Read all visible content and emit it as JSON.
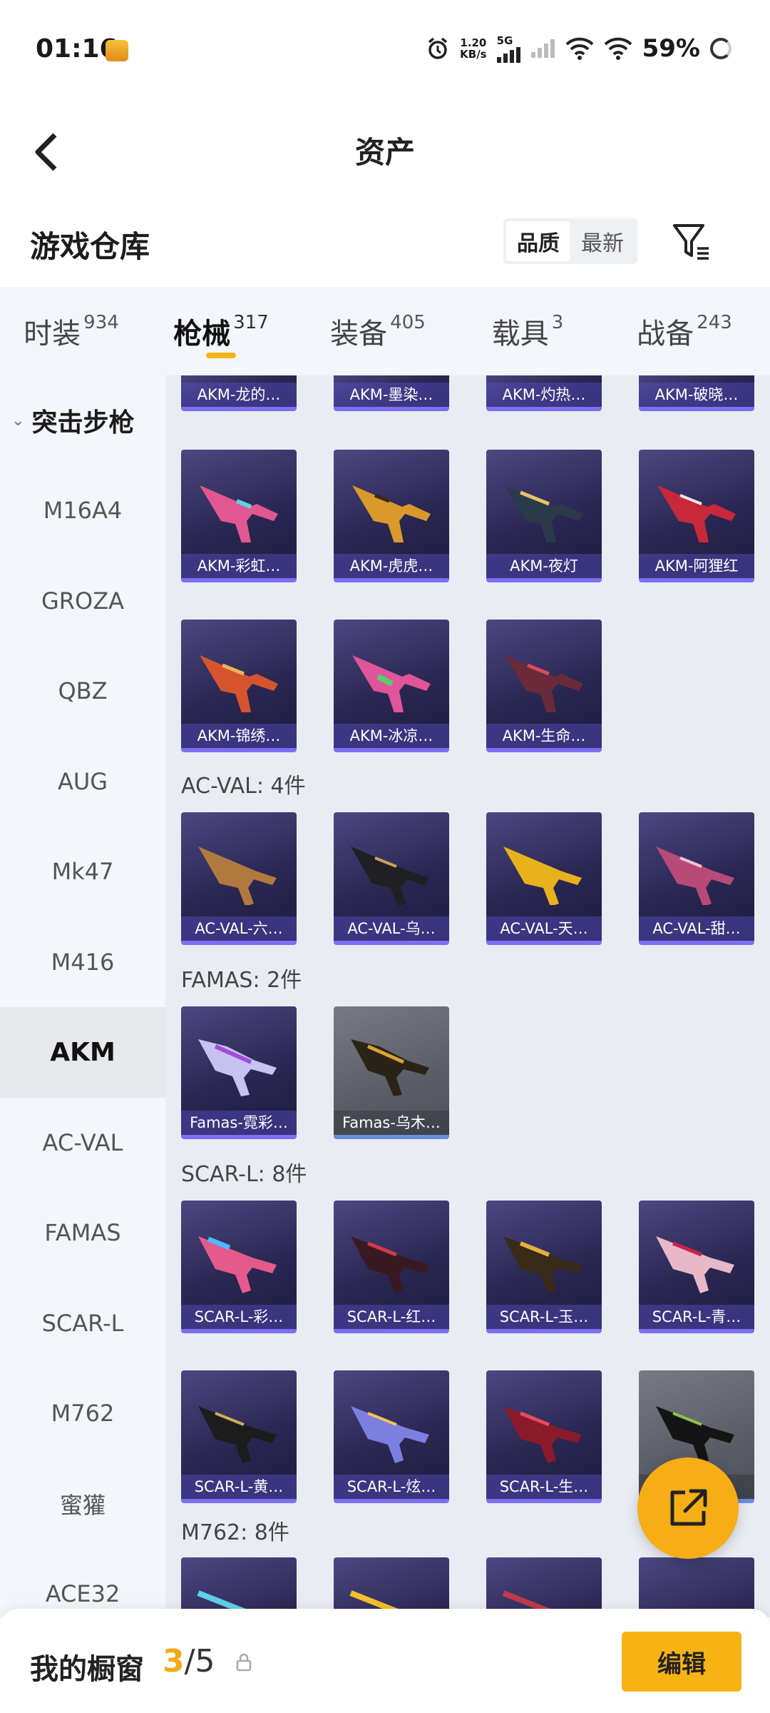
{
  "status_bar": {
    "time": "01:16",
    "speed_top": "1.20",
    "speed_bottom": "KB/s",
    "network": "5G",
    "battery": "59%"
  },
  "header": {
    "title": "资产"
  },
  "warehouse": {
    "title": "游戏仓库",
    "sort_options": [
      "品质",
      "最新"
    ],
    "active_sort": "品质"
  },
  "tabs": [
    {
      "label": "时装",
      "count": "934"
    },
    {
      "label": "枪械",
      "count": "317"
    },
    {
      "label": "装备",
      "count": "405"
    },
    {
      "label": "载具",
      "count": "3"
    },
    {
      "label": "战备",
      "count": "243"
    }
  ],
  "active_tab": "枪械",
  "rail": {
    "group": "突击步枪",
    "items": [
      "M16A4",
      "GROZA",
      "QBZ",
      "AUG",
      "Mk47",
      "M416",
      "AKM",
      "AC-VAL",
      "FAMAS",
      "SCAR-L",
      "M762",
      "蜜獾",
      "ACE32"
    ],
    "active": "AKM"
  },
  "sections": {
    "akm_top": [
      "AKM-龙的…",
      "AKM-墨染…",
      "AKM-灼热…",
      "AKM-破晓…"
    ],
    "akm_row2": [
      "AKM-彩虹…",
      "AKM-虎虎…",
      "AKM-夜灯",
      "AKM-阿狸红"
    ],
    "akm_row3": [
      "AKM-锦绣…",
      "AKM-冰凉…",
      "AKM-生命…"
    ],
    "acval": {
      "label": "AC-VAL: 4件",
      "items": [
        "AC-VAL-六…",
        "AC-VAL-乌…",
        "AC-VAL-天…",
        "AC-VAL-甜…"
      ]
    },
    "famas": {
      "label": "FAMAS: 2件",
      "items": [
        "Famas-霓彩…",
        "Famas-乌木…"
      ]
    },
    "scarl": {
      "label": "SCAR-L: 8件",
      "row1": [
        "SCAR-L-彩…",
        "SCAR-L-红…",
        "SCAR-L-玉…",
        "SCAR-L-青…"
      ],
      "row2": [
        "SCAR-L-黄…",
        "SCAR-L-炫…",
        "SCAR-L-生…",
        "…"
      ]
    },
    "m762": {
      "label": "M762: 8件"
    }
  },
  "bottom": {
    "showcase_label": "我的橱窗",
    "count_current": "3",
    "count_total": "/5",
    "edit_label": "编辑"
  },
  "colors": {
    "accent": "#f6b414",
    "card_bg": "#2a2752",
    "card_border": "#7d6ef2"
  }
}
